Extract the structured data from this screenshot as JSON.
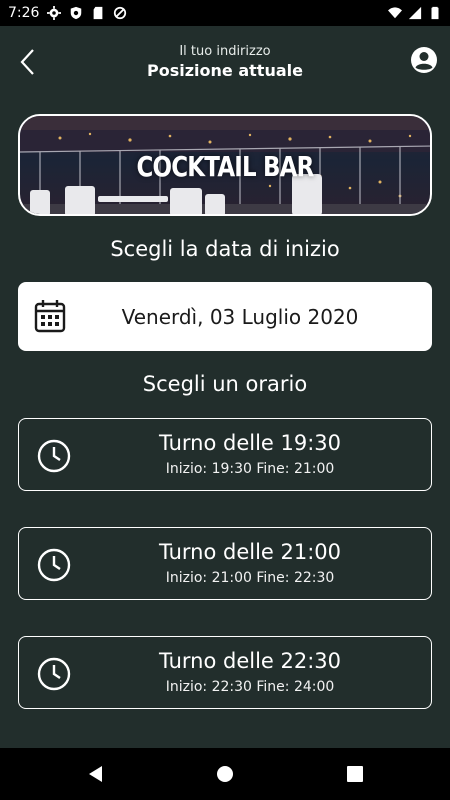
{
  "status_bar": {
    "time": "7:26"
  },
  "header": {
    "subtitle": "Il tuo indirizzo",
    "title": "Posizione attuale"
  },
  "banner": {
    "title": "COCKTAIL BAR"
  },
  "date_section": {
    "heading": "Scegli la data di inizio",
    "selected_date": "Venerdì, 03 Luglio 2020"
  },
  "time_section": {
    "heading": "Scegli un orario",
    "slots": [
      {
        "title": "Turno delle 19:30",
        "detail": "Inizio: 19:30 Fine: 21:00"
      },
      {
        "title": "Turno delle 21:00",
        "detail": "Inizio: 21:00 Fine: 22:30"
      },
      {
        "title": "Turno delle 22:30",
        "detail": "Inizio: 22:30 Fine: 24:00"
      }
    ]
  },
  "colors": {
    "background": "#222e2c",
    "card": "#ffffff",
    "system_bars": "#000000"
  }
}
